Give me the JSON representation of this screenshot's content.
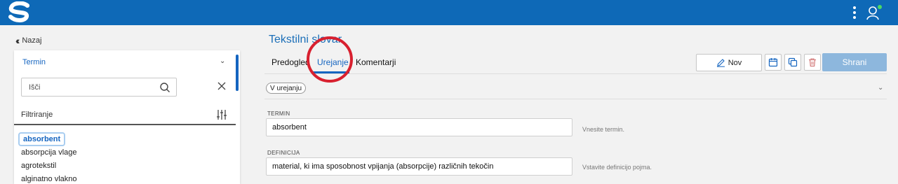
{
  "header": {
    "logo_icon": "s-logo-icon",
    "menu_icon": "kebab-menu-icon",
    "user_icon": "user-icon",
    "online_color": "#4cd964"
  },
  "back": {
    "label": "Nazaj"
  },
  "panel": {
    "header_label": "Termin",
    "search_placeholder": "Išči",
    "filter_label": "Filtriranje",
    "items": [
      "absorbent",
      "absorpcija vlage",
      "agrotekstil",
      "alginatno vlakno"
    ],
    "selected_index": 0
  },
  "main": {
    "title": "Tekstilni slovar",
    "tabs": [
      "Predogled",
      "Urejanje",
      "Komentarji"
    ],
    "active_tab": 1
  },
  "toolbar": {
    "new_label": "Nov",
    "save_label": "Shrani"
  },
  "status": {
    "badge": "V urejanju"
  },
  "form": {
    "term": {
      "label": "TERMIN",
      "value": "absorbent",
      "hint": "Vnesite termin."
    },
    "definition": {
      "label": "DEFINICIJA",
      "value": "material, ki ima sposobnost vpijanja (absorpcije) različnih tekočin",
      "hint": "Vstavite definicijo pojma."
    }
  },
  "colors": {
    "brand": "#0e69b7",
    "accent": "#1565c0",
    "save_disabled": "#8db7dd",
    "highlight": "#d8202f"
  }
}
